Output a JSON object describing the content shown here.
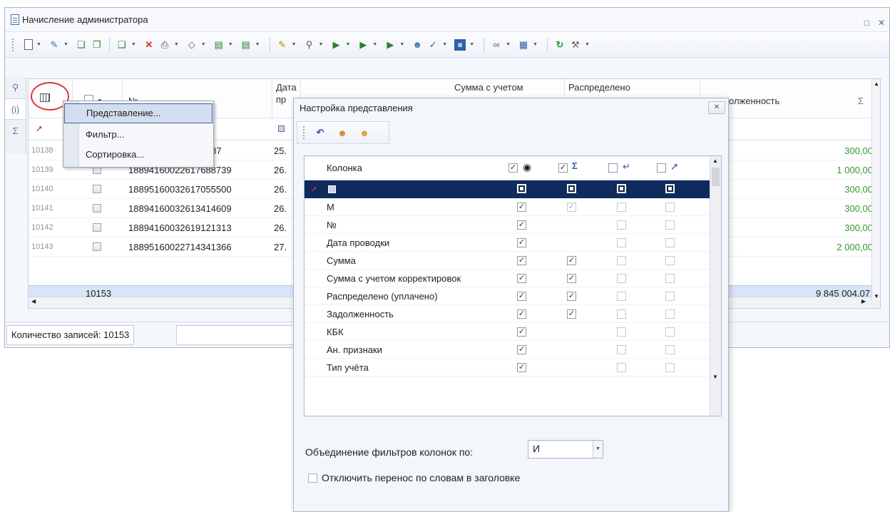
{
  "window": {
    "title": "Начисление администратора"
  },
  "grid": {
    "headers": {
      "number": "№",
      "date_line1": "Дата",
      "date_line2": "пр",
      "sum_corrected_line1": "Сумма с учетом",
      "distributed_line1": "Распределено",
      "debt": "олженность",
      "sigma": "Σ"
    },
    "rows": [
      {
        "id": "10138",
        "number": "7775787",
        "date": "25.",
        "amount": "300,00"
      },
      {
        "id": "10139",
        "number": "18894160022617688739",
        "date": "26.",
        "amount": "1 000,00"
      },
      {
        "id": "10140",
        "number": "18895160032617055500",
        "date": "26.",
        "amount": "300,00"
      },
      {
        "id": "10141",
        "number": "18894160032613414609",
        "date": "26.",
        "amount": "300,00"
      },
      {
        "id": "10142",
        "number": "18894160032619121313",
        "date": "26.",
        "amount": "300,00"
      },
      {
        "id": "10143",
        "number": "18895160022714341366",
        "date": "27.",
        "amount": "2 000,00"
      }
    ],
    "total_count": "10153",
    "total_amount": "9 845 004,07"
  },
  "status": {
    "records_label": "Количество записей: 10153"
  },
  "context_menu": {
    "items": [
      "Представление...",
      "Фильтр...",
      "Сортировка..."
    ]
  },
  "dialog": {
    "title": "Настройка представления",
    "column_header": "Колонка",
    "rows": [
      {
        "name": "М",
        "visible": true,
        "sum": true,
        "sum_disabled": true,
        "wrap": false,
        "pin": false
      },
      {
        "name": "№",
        "visible": true,
        "sum": null,
        "wrap": false,
        "pin": false
      },
      {
        "name": "Дата проводки",
        "visible": true,
        "sum": null,
        "wrap": false,
        "pin": false
      },
      {
        "name": "Сумма",
        "visible": true,
        "sum": true,
        "wrap": false,
        "pin": false
      },
      {
        "name": "Сумма с учетом корректировок",
        "visible": true,
        "sum": true,
        "wrap": false,
        "pin": false
      },
      {
        "name": "Распределено (уплачено)",
        "visible": true,
        "sum": true,
        "wrap": false,
        "pin": false
      },
      {
        "name": "Задолженность",
        "visible": true,
        "sum": true,
        "wrap": false,
        "pin": false
      },
      {
        "name": "КБК",
        "visible": true,
        "sum": null,
        "wrap": false,
        "pin": false
      },
      {
        "name": "Ан. признаки",
        "visible": true,
        "sum": null,
        "wrap": false,
        "pin": false
      },
      {
        "name": "Тип учёта",
        "visible": true,
        "sum": null,
        "wrap": false,
        "pin": false
      }
    ],
    "combine_label": "Объединение фильтров колонок по:",
    "combine_value": "И",
    "wrap_label": "Отключить перенос по словам в заголовке"
  },
  "colors": {
    "accent": "#0f2a5c",
    "amount": "#2e9a2e",
    "highlight_circle": "#d73a3a"
  }
}
